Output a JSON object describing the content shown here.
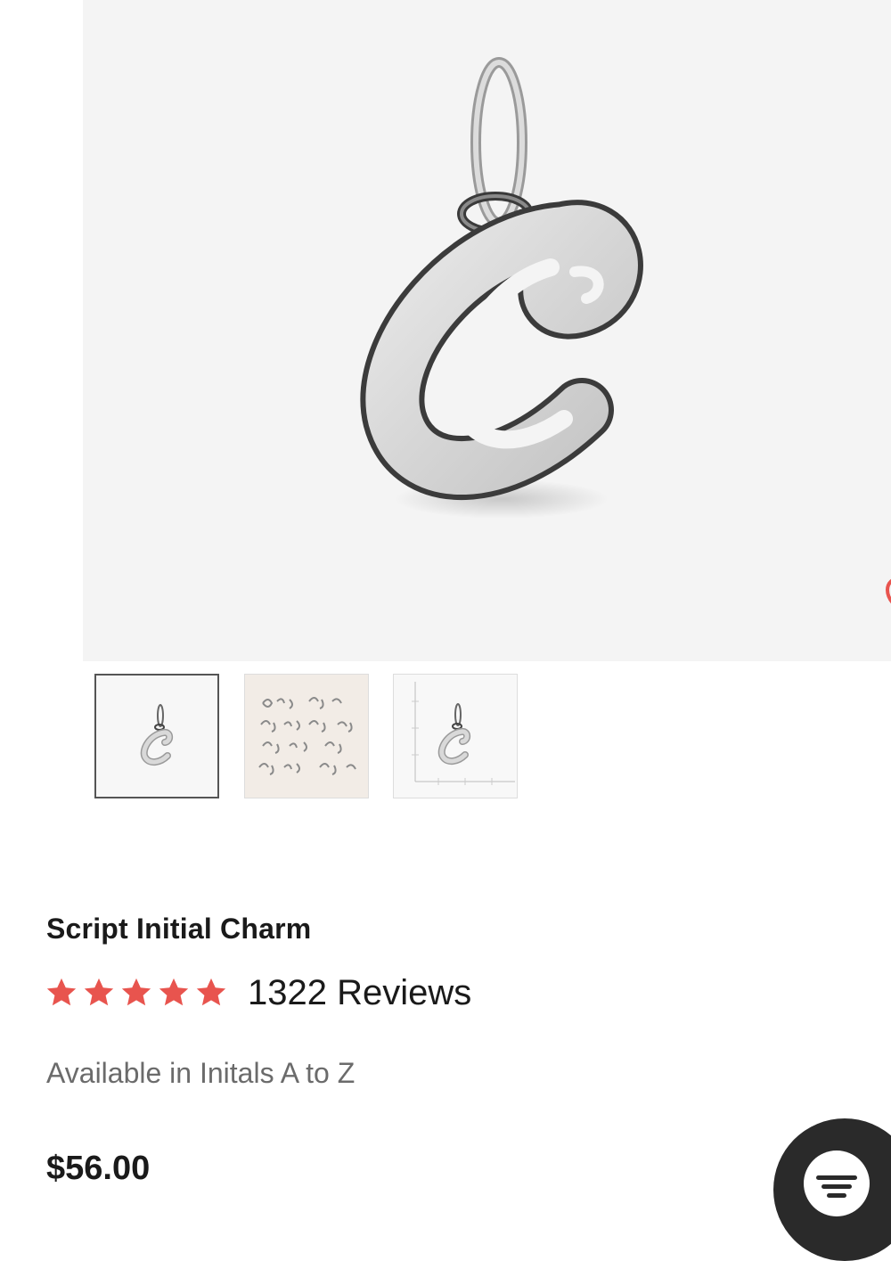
{
  "product": {
    "title": "Script Initial Charm",
    "rating": 5,
    "rating_max": 5,
    "reviews_label": "1322 Reviews",
    "availability": "Available in Initals A to Z",
    "price": "$56.00"
  },
  "gallery": {
    "selected_index": 0,
    "thumbnails": [
      {
        "name": "charm-front-thumbnail"
      },
      {
        "name": "all-initials-thumbnail"
      },
      {
        "name": "size-guide-thumbnail"
      }
    ]
  },
  "colors": {
    "accent": "#e8544e",
    "hero_background": "#f4f4f4",
    "text": "#1a1a1a",
    "muted_text": "#6b6b6b",
    "fab": "#2a2a2a"
  },
  "icons": {
    "favorite": "heart-outline-icon",
    "star": "star-icon",
    "menu": "menu-lines-icon"
  }
}
